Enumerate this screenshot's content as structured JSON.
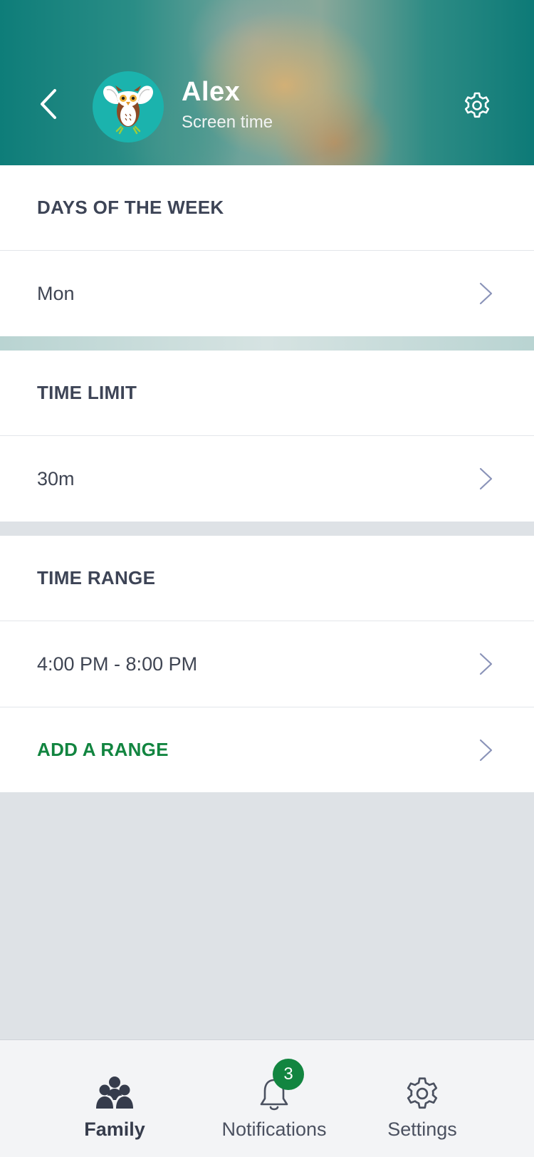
{
  "header": {
    "name": "Alex",
    "subtitle": "Screen time"
  },
  "sections": {
    "days": {
      "title": "DAYS OF THE WEEK",
      "value": "Mon"
    },
    "time_limit": {
      "title": "TIME LIMIT",
      "value": "30m"
    },
    "time_range": {
      "title": "TIME RANGE",
      "value": "4:00 PM - 8:00 PM",
      "add_label": "ADD A RANGE"
    }
  },
  "bottom_nav": {
    "items": [
      {
        "label": "Family",
        "icon": "family-icon",
        "active": true
      },
      {
        "label": "Notifications",
        "icon": "bell-icon",
        "badge": "3"
      },
      {
        "label": "Settings",
        "icon": "gear-icon"
      }
    ]
  },
  "colors": {
    "accent_green": "#128540",
    "header_teal": "#0e7d79",
    "text_dark": "#3d4456"
  }
}
